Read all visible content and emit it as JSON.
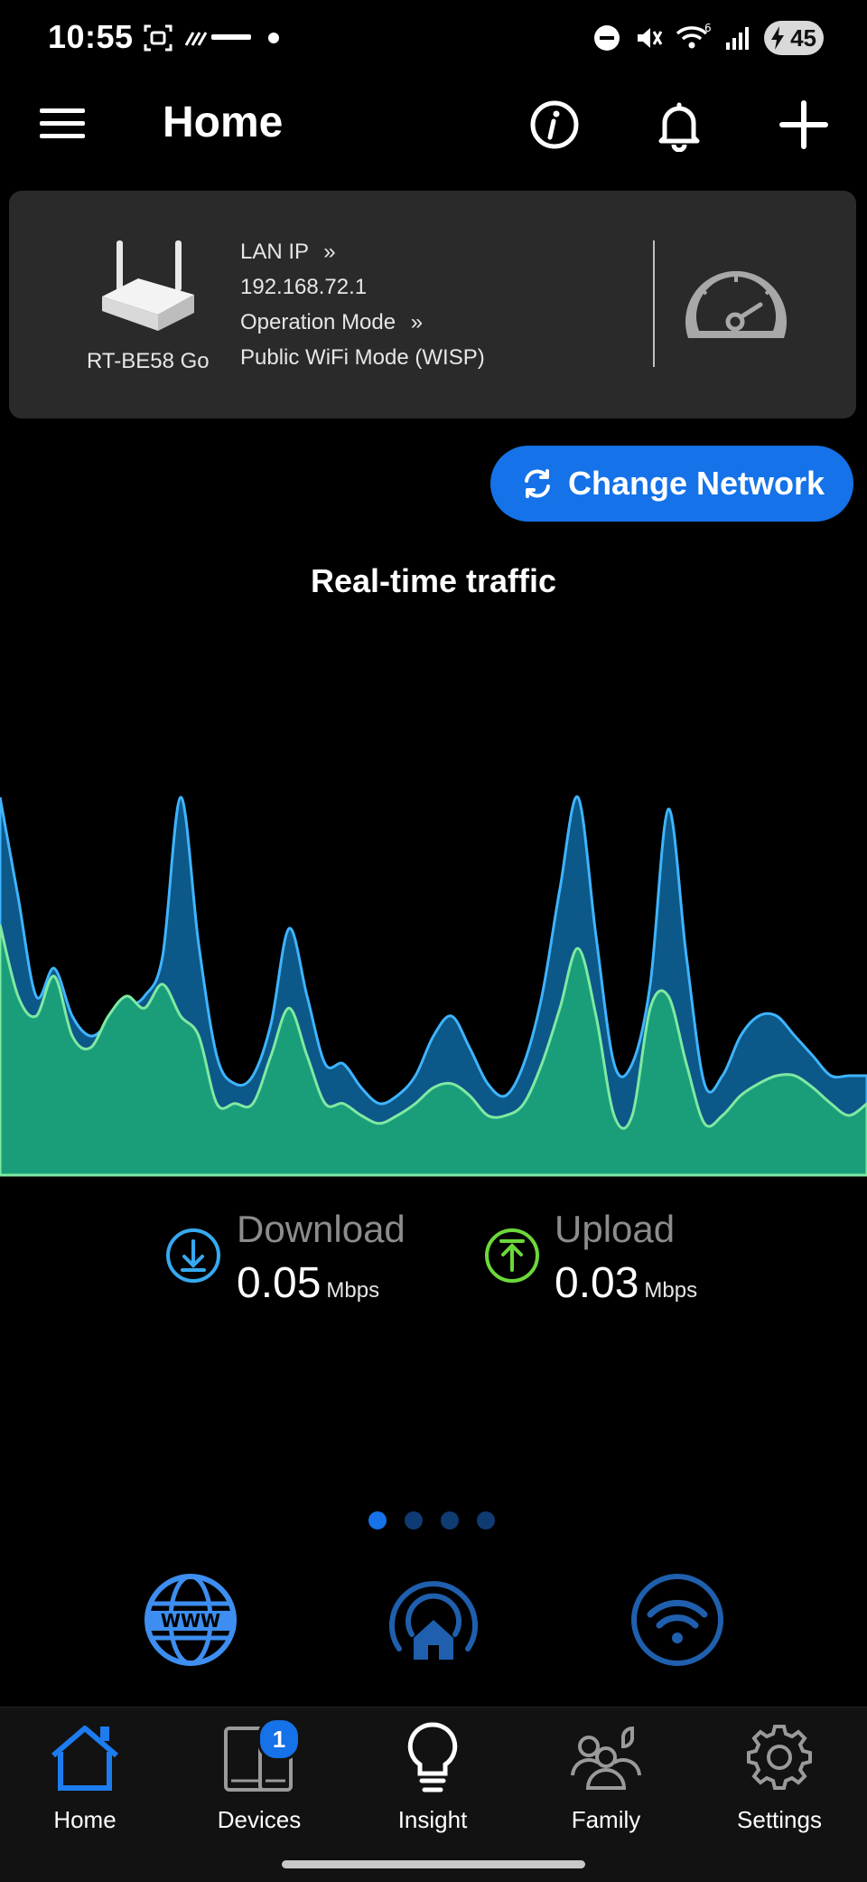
{
  "status_bar": {
    "time": "10:55",
    "battery_level": "45",
    "icons": [
      "screenshot-icon",
      "soundbar-icon",
      "dot-icon",
      "dnd-icon",
      "mute-icon",
      "wifi6-icon",
      "signal-icon",
      "battery-icon"
    ]
  },
  "header": {
    "title": "Home",
    "icons": [
      "menu-icon",
      "info-icon",
      "bell-icon",
      "plus-icon"
    ]
  },
  "router": {
    "name": "RT-BE58 Go",
    "lan_ip_label": "LAN IP",
    "lan_ip": "192.168.72.1",
    "operation_mode_label": "Operation Mode",
    "operation_mode": "Public WiFi Mode (WISP)"
  },
  "change_network_label": "Change Network",
  "traffic": {
    "title": "Real-time traffic",
    "download": {
      "label": "Download",
      "value": "0.05",
      "unit": "Mbps"
    },
    "upload": {
      "label": "Upload",
      "value": "0.03",
      "unit": "Mbps"
    }
  },
  "chart_data": {
    "type": "area",
    "x": [
      0,
      1,
      2,
      3,
      4,
      5,
      6,
      7,
      8,
      9,
      10,
      11,
      12,
      13,
      14,
      15,
      16,
      17,
      18,
      19,
      20,
      21,
      22,
      23,
      24,
      25,
      26,
      27,
      28,
      29,
      30,
      31,
      32,
      33,
      34,
      35,
      36,
      37,
      38,
      39,
      40,
      41,
      42,
      43,
      44,
      45,
      46,
      47,
      48
    ],
    "series": [
      {
        "values": [
          95,
          70,
          45,
          52,
          40,
          35,
          38,
          42,
          45,
          55,
          95,
          58,
          30,
          23,
          25,
          38,
          62,
          45,
          28,
          28,
          22,
          18,
          20,
          25,
          35,
          40,
          32,
          23,
          20,
          28,
          45,
          72,
          95,
          60,
          28,
          28,
          48,
          92,
          55,
          23,
          25,
          35,
          40,
          40,
          35,
          30,
          25,
          25,
          25
        ]
      },
      {
        "values": [
          63,
          45,
          40,
          50,
          35,
          32,
          40,
          45,
          42,
          48,
          40,
          35,
          18,
          18,
          18,
          30,
          42,
          30,
          18,
          18,
          15,
          13,
          15,
          18,
          22,
          23,
          20,
          15,
          15,
          18,
          28,
          42,
          57,
          40,
          15,
          15,
          42,
          45,
          28,
          13,
          15,
          20,
          23,
          25,
          25,
          22,
          18,
          15,
          18
        ]
      }
    ],
    "colors": [
      "#1c8de8",
      "#21c29a"
    ]
  },
  "pagination": {
    "count": 4,
    "active": 0
  },
  "features": [
    "www-globe-icon",
    "home-wifi-icon",
    "wifi-icon"
  ],
  "bottom_nav": [
    {
      "label": "Home",
      "icon": "home-icon",
      "active": true
    },
    {
      "label": "Devices",
      "icon": "devices-icon",
      "badge": "1"
    },
    {
      "label": "Insight",
      "icon": "lightbulb-icon"
    },
    {
      "label": "Family",
      "icon": "family-icon"
    },
    {
      "label": "Settings",
      "icon": "gear-icon"
    }
  ]
}
